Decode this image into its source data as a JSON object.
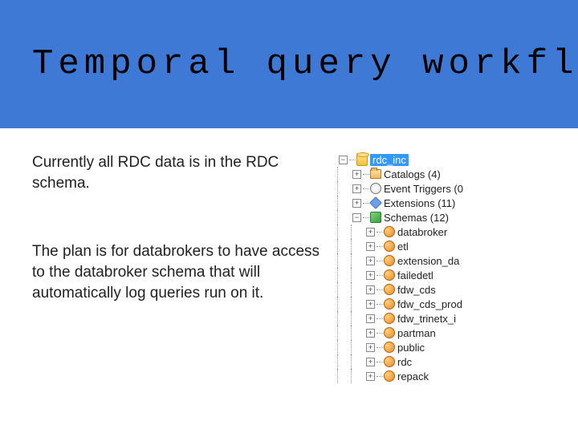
{
  "title": "Temporal query workflow",
  "paragraph1": "Currently all RDC data is in the RDC schema.",
  "paragraph2": "The plan is for databrokers to have access to the databroker schema that will automatically log queries run on it.",
  "tree": {
    "root": "rdc_inc",
    "catalogs": "Catalogs (4)",
    "event_triggers": "Event Triggers (0",
    "extensions": "Extensions (11)",
    "schemas": "Schemas (12)",
    "schema_items": {
      "s0": "databroker",
      "s1": "etl",
      "s2": "extension_da",
      "s3": "failedetl",
      "s4": "fdw_cds",
      "s5": "fdw_cds_prod",
      "s6": "fdw_trinetx_i",
      "s7": "partman",
      "s8": "public",
      "s9": "rdc",
      "s10": "repack"
    }
  }
}
